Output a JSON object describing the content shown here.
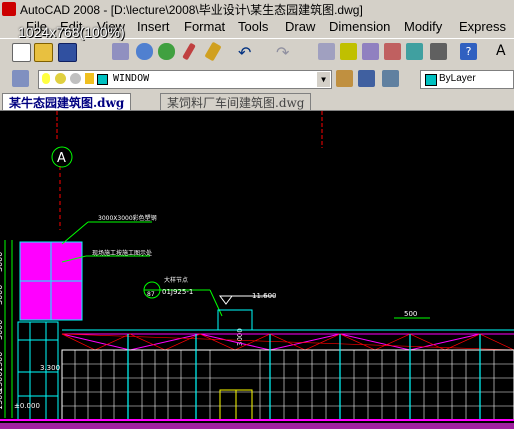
{
  "window": {
    "title": "AutoCAD 2008 - [D:\\lecture\\2008\\毕业设计\\某生态园建筑图.dwg]",
    "resolution_overlay": "1024x768(100%)"
  },
  "menu": {
    "items": [
      "File",
      "Edit",
      "View",
      "Insert",
      "Format",
      "Tools",
      "Draw",
      "Dimension",
      "Modify",
      "Express"
    ]
  },
  "toolbar": {
    "layer_name": "WINDOW",
    "color_value": "ByLayer",
    "color_hex": "#00c0c0"
  },
  "tabs": [
    {
      "label": "某牛态园建筑图.dwg",
      "active": true
    },
    {
      "label": "某饲料厂车间建筑图.dwg",
      "active": false
    }
  ],
  "drawing": {
    "grid_label": "A",
    "annotations": {
      "board": "3000X3000彩色塑钢",
      "board_note": "现场施工按施工图示处",
      "detail_ref": "大样节点",
      "detail_code": "01J925-1",
      "detail_num": "87",
      "elev_top": "11.600",
      "dim_right": "500",
      "dim_mid": "3000",
      "left_dims": [
        "3000",
        "3000",
        "3000",
        "1500",
        "1500",
        "1500"
      ],
      "level_1": "3.300",
      "level_2": "±0.000"
    },
    "colors": {
      "magenta": "#ff00ff",
      "cyan": "#00ffff",
      "green": "#00ff00",
      "white": "#ffffff",
      "red": "#ff0000",
      "yellow": "#ffff00"
    }
  }
}
